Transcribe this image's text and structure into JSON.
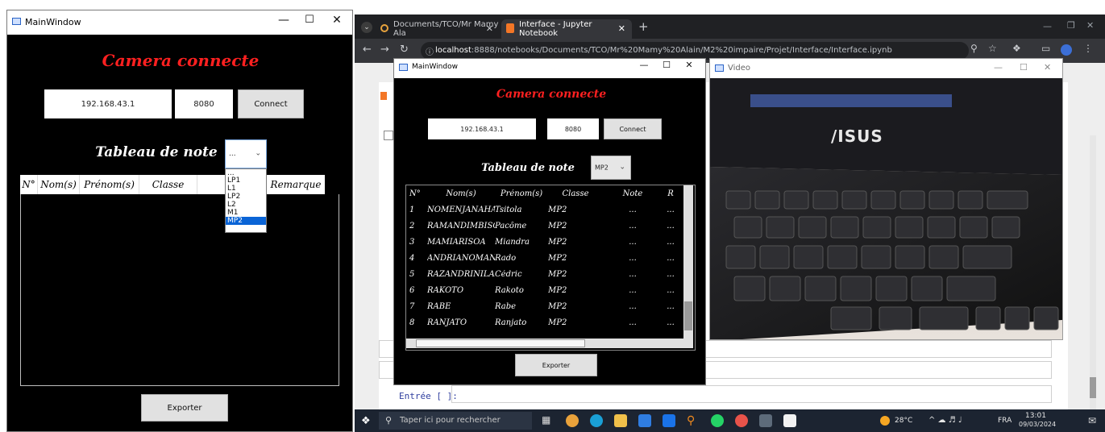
{
  "left_window": {
    "title": "MainWindow",
    "camera_status": "Camera connecte",
    "ip_value": "192.168.43.1",
    "port_value": "8080",
    "connect_label": "Connect",
    "table_title": "Tableau de note",
    "class_selected": "...",
    "class_options": [
      "...",
      "LP1",
      "L1",
      "LP2",
      "L2",
      "M1",
      "MP2"
    ],
    "columns": [
      "N°",
      "Nom(s)",
      "Prénom(s)",
      "Classe",
      "N",
      "Remarque"
    ],
    "export_label": "Exporter"
  },
  "browser": {
    "tabs": [
      {
        "label": "Documents/TCO/Mr Mamy Ala"
      },
      {
        "label": "Interface - Jupyter Notebook"
      }
    ],
    "url_host": "localhost",
    "url_rest": ":8888/notebooks/Documents/TCO/Mr%20Mamy%20Alain/M2%20impaire/Projet/Interface/Interface.ipynb",
    "cell_prompt": "Entrée [ ]:"
  },
  "inner_window": {
    "title": "MainWindow",
    "camera_status": "Camera connecte",
    "ip_value": "192.168.43.1",
    "port_value": "8080",
    "connect_label": "Connect",
    "table_title": "Tableau de note",
    "class_selected": "MP2",
    "columns": [
      "N°",
      "Nom(s)",
      "Prénom(s)",
      "Classe",
      "Note",
      "R"
    ],
    "rows": [
      {
        "n": "1",
        "nom": "NOMENJANAHARY",
        "prenom": "Tsitola",
        "classe": "MP2",
        "note": "...",
        "rem": "..."
      },
      {
        "n": "2",
        "nom": "RAMANDIMBISON",
        "prenom": "Pacôme",
        "classe": "MP2",
        "note": "...",
        "rem": "..."
      },
      {
        "n": "3",
        "nom": "MAMIARISOA",
        "prenom": "Miandra",
        "classe": "MP2",
        "note": "...",
        "rem": "..."
      },
      {
        "n": "4",
        "nom": "ANDRIANOMANANA",
        "prenom": "Rado",
        "classe": "MP2",
        "note": "...",
        "rem": "..."
      },
      {
        "n": "5",
        "nom": "RAZANDRINILAINA",
        "prenom": "Cédric",
        "classe": "MP2",
        "note": "...",
        "rem": "..."
      },
      {
        "n": "6",
        "nom": "RAKOTO",
        "prenom": "Rakoto",
        "classe": "MP2",
        "note": "...",
        "rem": "..."
      },
      {
        "n": "7",
        "nom": "RABE",
        "prenom": "Rabe",
        "classe": "MP2",
        "note": "...",
        "rem": "..."
      },
      {
        "n": "8",
        "nom": "RANJATO",
        "prenom": "Ranjato",
        "classe": "MP2",
        "note": "...",
        "rem": "..."
      }
    ],
    "export_label": "Exporter"
  },
  "video_window": {
    "title": "Video",
    "brand": "/ISUS"
  },
  "taskbar": {
    "search_placeholder": "Taper ici pour rechercher",
    "weather": "28°C",
    "lang": "FRA",
    "time": "13:01",
    "date": "09/03/2024"
  },
  "colors": {
    "title_red": "#ff2020",
    "selection_blue": "#0a64d6",
    "chrome_dark": "#202124",
    "taskbar": "#1c2431"
  }
}
